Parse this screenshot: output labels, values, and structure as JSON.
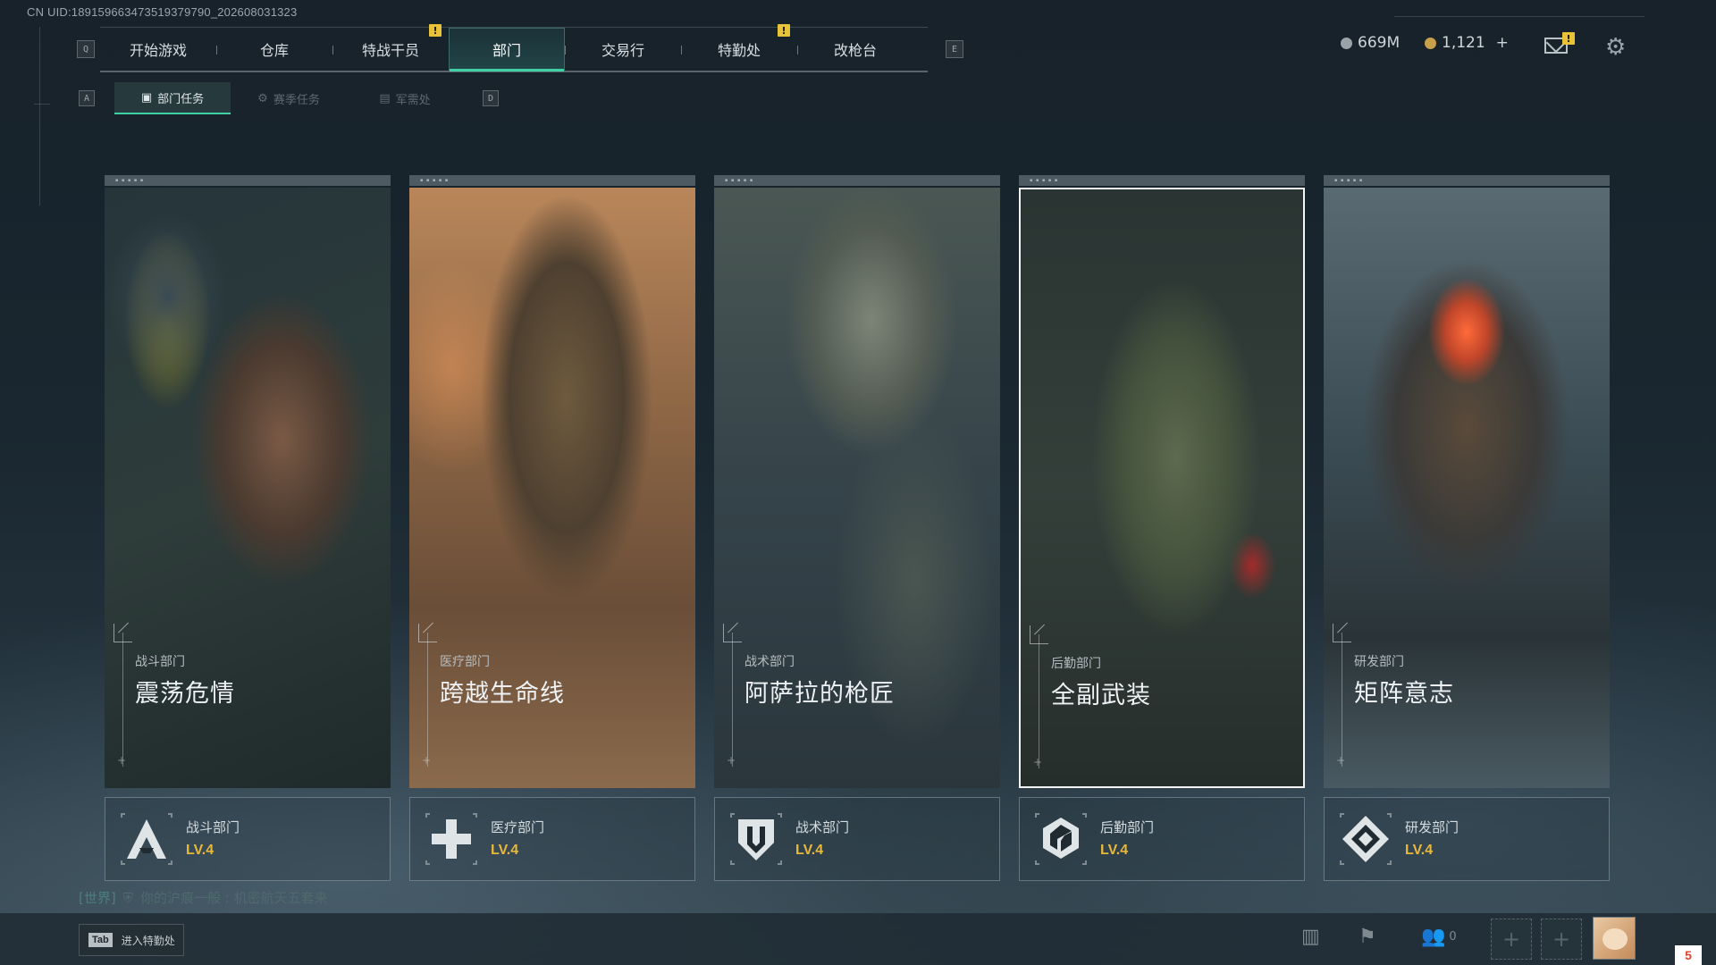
{
  "uid_text": "CN UID:189159663473519379790_202608031323",
  "nav": {
    "left_key": "Q",
    "right_key": "E",
    "tabs": [
      {
        "label": "开始游戏",
        "badge": ""
      },
      {
        "label": "仓库",
        "badge": ""
      },
      {
        "label": "特战干员",
        "badge": "!"
      },
      {
        "label": "部门",
        "badge": "",
        "active": true
      },
      {
        "label": "交易行",
        "badge": ""
      },
      {
        "label": "特勤处",
        "badge": "!"
      },
      {
        "label": "改枪台",
        "badge": ""
      }
    ]
  },
  "subnav": {
    "left_key": "A",
    "right_key": "D",
    "tabs": [
      {
        "label": "部门任务",
        "icon": "task-icon",
        "active": true
      },
      {
        "label": "赛季任务",
        "icon": "season-icon"
      },
      {
        "label": "军需处",
        "icon": "supply-icon"
      }
    ]
  },
  "currency": {
    "silver": "669M",
    "gold": "1,121",
    "gold_add": "+",
    "silver_color": "#9aa3a8",
    "gold_color": "#c9a04a"
  },
  "mail_badge": "!",
  "departments": [
    {
      "category": "战斗部门",
      "title": "震荡危情",
      "name": "战斗部门",
      "level": "LV.4",
      "icon": "combat-icon"
    },
    {
      "category": "医疗部门",
      "title": "跨越生命线",
      "name": "医疗部门",
      "level": "LV.4",
      "icon": "medical-cross-icon"
    },
    {
      "category": "战术部门",
      "title": "阿萨拉的枪匠",
      "name": "战术部门",
      "level": "LV.4",
      "icon": "tactical-shield-icon"
    },
    {
      "category": "后勤部门",
      "title": "全副武装",
      "name": "后勤部门",
      "level": "LV.4",
      "icon": "logistics-icon",
      "selected": true
    },
    {
      "category": "研发部门",
      "title": "矩阵意志",
      "name": "研发部门",
      "level": "LV.4",
      "icon": "research-icon"
    }
  ],
  "chat": {
    "channel": "[世界]",
    "message": "你的沪痕一般 :  机密航天五套来"
  },
  "bottom": {
    "tab_key": "Tab",
    "tab_label": "进入特勤处",
    "friends_count": "0",
    "corner_badge": "5"
  },
  "colors": {
    "accent": "#3fd0a3",
    "level": "#e8b83a",
    "badge": "#e8c33a"
  }
}
